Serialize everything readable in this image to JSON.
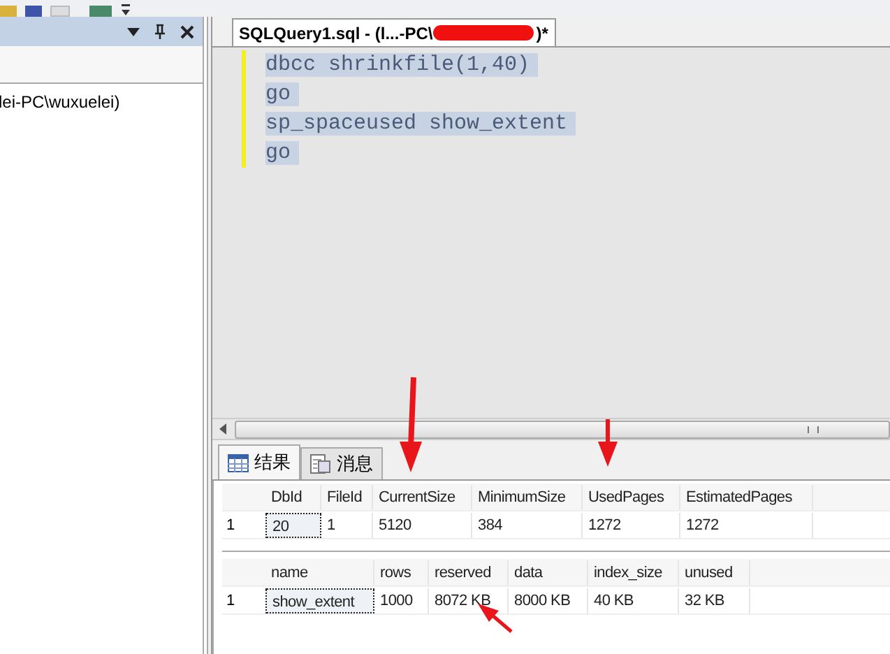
{
  "object_explorer": {
    "tree_item": "lei-PC\\wuxuelei)"
  },
  "editor": {
    "tab": {
      "title": "SQLQuery1.sql - (l...-PC\\",
      "title_end": ")*",
      "selected": true
    },
    "lines": [
      "dbcc shrinkfile(1,40)",
      "go",
      "sp_spaceused show_extent",
      "go"
    ]
  },
  "results": {
    "tabs": [
      {
        "label": "结果",
        "kind": "grid",
        "selected": true
      },
      {
        "label": "消息",
        "kind": "messages",
        "selected": false
      }
    ],
    "grids": [
      {
        "columns": [
          "DbId",
          "FileId",
          "CurrentSize",
          "MinimumSize",
          "UsedPages",
          "EstimatedPages"
        ],
        "rows": [
          {
            "number": "1",
            "cells": [
              "20",
              "1",
              "5120",
              "384",
              "1272",
              "1272"
            ]
          }
        ]
      },
      {
        "columns": [
          "name",
          "rows",
          "reserved",
          "data",
          "index_size",
          "unused"
        ],
        "rows": [
          {
            "number": "1",
            "cells": [
              "show_extent",
              "1000",
              "8072 KB",
              "8000 KB",
              "40 KB",
              "32 KB"
            ]
          }
        ]
      }
    ]
  }
}
